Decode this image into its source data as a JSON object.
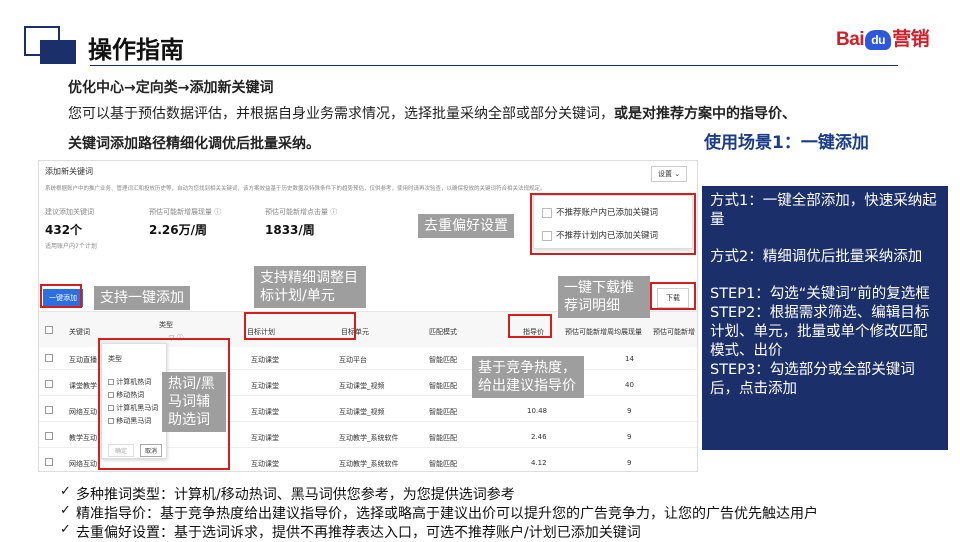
{
  "header": {
    "title": "操作指南",
    "logo_left": "Bai",
    "logo_paw": "du",
    "logo_right": "营销"
  },
  "intro": {
    "subtitle": "优化中心→定向类→添加新关键词",
    "line1_normal": "您可以基于预估数据评估，并根据自身业务需求情况，选择批量采纳全部或部分关键词，",
    "line1_bold": "或是对推荐方案中的指导价、",
    "line2": "关键词添加路径精细化调优后批量采纳。",
    "scene": "使用场景1：一键添加"
  },
  "screenshot": {
    "dialog_title": "添加新关键词",
    "settings_label": "设置",
    "notice": "系统根据账户中的推广业务、管理词汇和投放历史等，自动为您找到相关关键词，该方案效益基于历史数据及特殊条件下的趋势预估，仅供参考，使用时请再次验查，以确保投放的关键词符合相关法规规定。",
    "stats": [
      {
        "label": "建议添加关键词",
        "value": "432个",
        "note": "适用账户内7个计划"
      },
      {
        "label": "预估可能新增展现量 ⓘ",
        "value": "2.26万/周",
        "note": ""
      },
      {
        "label": "预估可能新增点击量 ⓘ",
        "value": "1833/周",
        "note": ""
      }
    ],
    "pref_options": [
      "不推荐账户内已添加关键词",
      "不推荐计划内已添加关键词"
    ],
    "add_button": "一键添加",
    "download_button": "下载",
    "columns": [
      "关键词",
      "类型",
      "目标计划",
      "目标单元",
      "匹配模式",
      "指导价",
      "预估可能新增周均展现量",
      "预估可能新增"
    ],
    "type_filter_icon": "▽ ⓘ",
    "rows": [
      {
        "kw": "互动直播",
        "plan": "互动课堂",
        "unit": "互动平台",
        "match": "智能匹配",
        "price": "",
        "shows": "14"
      },
      {
        "kw": "课堂教学",
        "plan": "互动课堂",
        "unit": "互动课堂_视频",
        "match": "智能匹配",
        "price": "",
        "shows": "40"
      },
      {
        "kw": "网络互动",
        "plan": "互动课堂",
        "unit": "互动课堂_视频",
        "match": "智能匹配",
        "price": "10.48",
        "shows": "9"
      },
      {
        "kw": "教学互动",
        "plan": "互动课堂",
        "unit": "互动教学_系统软件",
        "match": "智能匹配",
        "price": "2.46",
        "shows": "9"
      },
      {
        "kw": "网络互动",
        "plan": "互动课堂",
        "unit": "互动教学_系统软件",
        "match": "智能匹配",
        "price": "4.12",
        "shows": "9"
      }
    ],
    "type_popup": {
      "title": "类型",
      "options": [
        "计算机热词",
        "移动热词",
        "计算机黑马词",
        "移动黑马词"
      ],
      "ok": "确定",
      "cancel": "取消"
    }
  },
  "callouts": {
    "pref": "去重偏好设置",
    "add": "支持一键添加",
    "adjust": "支持精细调整目标计划/单元",
    "download": "一键下载推荐词明细",
    "price": "基于竞争热度，给出建议指导价",
    "type": "热词/黑马词辅助选词"
  },
  "panel": {
    "lines": [
      "方式1：一键全部添加，快速采纳起量",
      "方式2：精细调优后批量采纳添加",
      "STEP1：勾选“关键词”前的复选框",
      "STEP2：根据需求筛选、编辑目标计划、单元，批量或单个修改匹配模式、出价",
      "STEP3：勾选部分或全部关键词后，点击添加"
    ]
  },
  "bullets": {
    "mark": "✓",
    "items": [
      "多种推词类型：计算机/移动热词、黑马词供您参考，为您提供选词参考",
      "精准指导价：基于竞争热度给出建议指导价，选择或略高于建议出价可以提升您的广告竞争力，让您的广告优先触达用户",
      "去重偏好设置：基于选词诉求，提供不再推荐表达入口，可选不推荐账户/计划已添加关键词"
    ]
  },
  "colors": {
    "navy": "#1b2f6b",
    "red": "#d21e1e",
    "blue": "#2b6fe0",
    "callout_grey": "#9e9e9e"
  }
}
